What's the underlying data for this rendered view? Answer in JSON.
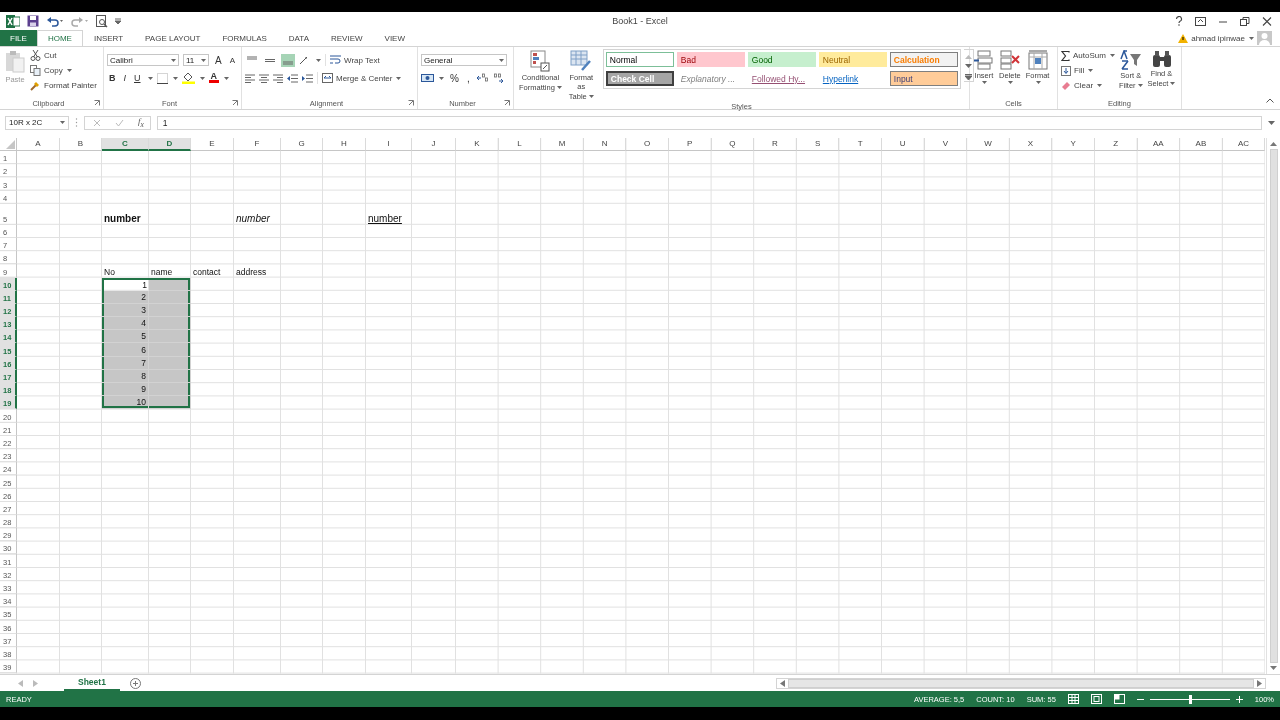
{
  "window": {
    "title": "Book1 - Excel",
    "user": "ahmad ipinwae"
  },
  "tabs": [
    {
      "label": "FILE",
      "kind": "file",
      "selected": false
    },
    {
      "label": "HOME",
      "kind": "tab",
      "selected": true
    },
    {
      "label": "INSERT",
      "kind": "tab",
      "selected": false
    },
    {
      "label": "PAGE LAYOUT",
      "kind": "tab",
      "selected": false
    },
    {
      "label": "FORMULAS",
      "kind": "tab",
      "selected": false
    },
    {
      "label": "DATA",
      "kind": "tab",
      "selected": false
    },
    {
      "label": "REVIEW",
      "kind": "tab",
      "selected": false
    },
    {
      "label": "VIEW",
      "kind": "tab",
      "selected": false
    }
  ],
  "ribbon": {
    "clipboard": {
      "label": "Clipboard",
      "paste": "Paste",
      "actions": [
        "Cut",
        "Copy",
        "Format Painter"
      ]
    },
    "font": {
      "label": "Font",
      "family": "Calibri",
      "size": "11",
      "grow": "A",
      "shrink": "A",
      "bold": "B",
      "italic": "I",
      "underline": "U",
      "color_letter": "A"
    },
    "alignment": {
      "label": "Alignment",
      "vertical": [
        {
          "selected": false
        },
        {
          "selected": false
        },
        {
          "selected": true
        }
      ],
      "wrap": "Wrap Text",
      "merge": "Merge & Center"
    },
    "number": {
      "label": "Number",
      "format": "General",
      "percent": "%",
      "comma": ","
    },
    "styles": {
      "label": "Styles",
      "conditional": [
        "Conditional",
        "Formatting"
      ],
      "format_table": [
        "Format as",
        "Table"
      ],
      "gallery": [
        {
          "label": "Normal",
          "kind": "normal",
          "selected": true
        },
        {
          "label": "Bad",
          "kind": "bad",
          "selected": false
        },
        {
          "label": "Good",
          "kind": "good",
          "selected": false
        },
        {
          "label": "Neutral",
          "kind": "neutral",
          "selected": false
        },
        {
          "label": "Calculation",
          "kind": "calculation",
          "selected": false
        },
        {
          "label": "Check Cell",
          "kind": "check",
          "selected": false
        },
        {
          "label": "Explanatory ...",
          "kind": "explanatory",
          "selected": false
        },
        {
          "label": "Followed Hy...",
          "kind": "followed",
          "selected": false
        },
        {
          "label": "Hyperlink",
          "kind": "hyperlink",
          "selected": false
        },
        {
          "label": "Input",
          "kind": "input",
          "selected": false
        }
      ]
    },
    "cells": {
      "label": "Cells",
      "buttons": [
        "Insert",
        "Delete",
        "Format"
      ]
    },
    "editing": {
      "label": "Editing",
      "autosum": "AutoSum",
      "fill": "Fill",
      "clear": "Clear",
      "sort": [
        "Sort &",
        "Filter"
      ],
      "find": [
        "Find &",
        "Select"
      ]
    }
  },
  "formula_bar": {
    "name_box": "10R x 2C",
    "function_label": "f$_{x}$",
    "value": "1"
  },
  "sheet": {
    "columns": [
      {
        "label": "A",
        "selected": false
      },
      {
        "label": "B",
        "selected": false
      },
      {
        "label": "C",
        "selected": true
      },
      {
        "label": "D",
        "selected": true
      },
      {
        "label": "E",
        "selected": false
      },
      {
        "label": "F",
        "selected": false
      },
      {
        "label": "G",
        "selected": false
      },
      {
        "label": "H",
        "selected": false
      },
      {
        "label": "I",
        "selected": false
      },
      {
        "label": "J",
        "selected": false
      },
      {
        "label": "K",
        "selected": false
      },
      {
        "label": "L",
        "selected": false
      },
      {
        "label": "M",
        "selected": false
      },
      {
        "label": "N",
        "selected": false
      },
      {
        "label": "O",
        "selected": false
      },
      {
        "label": "P",
        "selected": false
      },
      {
        "label": "Q",
        "selected": false
      },
      {
        "label": "R",
        "selected": false
      },
      {
        "label": "S",
        "selected": false
      },
      {
        "label": "T",
        "selected": false
      },
      {
        "label": "U",
        "selected": false
      },
      {
        "label": "V",
        "selected": false
      },
      {
        "label": "W",
        "selected": false
      },
      {
        "label": "X",
        "selected": false
      },
      {
        "label": "Y",
        "selected": false
      },
      {
        "label": "Z",
        "selected": false
      },
      {
        "label": "AA",
        "selected": false
      },
      {
        "label": "AB",
        "selected": false
      },
      {
        "label": "AC",
        "selected": false
      }
    ],
    "rows": [
      {
        "label": "1",
        "selected": false
      },
      {
        "label": "2",
        "selected": false
      },
      {
        "label": "3",
        "selected": false
      },
      {
        "label": "4",
        "selected": false
      },
      {
        "label": "5",
        "selected": false,
        "cells": [
          null,
          null,
          {
            "text": "number",
            "kind": "bold",
            "selected": false
          },
          null,
          null,
          {
            "text": "number",
            "kind": "italic",
            "selected": false
          },
          null,
          null,
          {
            "text": "number",
            "kind": "underlined",
            "selected": false
          }
        ]
      },
      {
        "label": "6",
        "selected": false
      },
      {
        "label": "7",
        "selected": false
      },
      {
        "label": "8",
        "selected": false
      },
      {
        "label": "9",
        "selected": false,
        "cells": [
          null,
          null,
          {
            "text": "No",
            "selected": false
          },
          {
            "text": "name",
            "selected": false
          },
          {
            "text": "contact",
            "selected": false
          },
          {
            "text": "address",
            "selected": false
          }
        ]
      },
      {
        "label": "10",
        "selected": true,
        "cells": [
          null,
          null,
          {
            "text": "1",
            "kind": "number",
            "selected": true,
            "active": true
          },
          {
            "selected": true
          }
        ]
      },
      {
        "label": "11",
        "selected": true,
        "cells": [
          null,
          null,
          {
            "text": "2",
            "kind": "number",
            "selected": true
          },
          {
            "selected": true
          }
        ]
      },
      {
        "label": "12",
        "selected": true,
        "cells": [
          null,
          null,
          {
            "text": "3",
            "kind": "number",
            "selected": true
          },
          {
            "selected": true
          }
        ]
      },
      {
        "label": "13",
        "selected": true,
        "cells": [
          null,
          null,
          {
            "text": "4",
            "kind": "number",
            "selected": true
          },
          {
            "selected": true
          }
        ]
      },
      {
        "label": "14",
        "selected": true,
        "cells": [
          null,
          null,
          {
            "text": "5",
            "kind": "number",
            "selected": true
          },
          {
            "selected": true
          }
        ]
      },
      {
        "label": "15",
        "selected": true,
        "cells": [
          null,
          null,
          {
            "text": "6",
            "kind": "number",
            "selected": true
          },
          {
            "selected": true
          }
        ]
      },
      {
        "label": "16",
        "selected": true,
        "cells": [
          null,
          null,
          {
            "text": "7",
            "kind": "number",
            "selected": true
          },
          {
            "selected": true
          }
        ]
      },
      {
        "label": "17",
        "selected": true,
        "cells": [
          null,
          null,
          {
            "text": "8",
            "kind": "number",
            "selected": true
          },
          {
            "selected": true
          }
        ]
      },
      {
        "label": "18",
        "selected": true,
        "cells": [
          null,
          null,
          {
            "text": "9",
            "kind": "number",
            "selected": true
          },
          {
            "selected": true
          }
        ]
      },
      {
        "label": "19",
        "selected": true,
        "cells": [
          null,
          null,
          {
            "text": "10",
            "kind": "number",
            "selected": true
          },
          {
            "selected": true
          }
        ]
      },
      {
        "label": "20",
        "selected": false
      },
      {
        "label": "21",
        "selected": false
      },
      {
        "label": "22",
        "selected": false
      },
      {
        "label": "23",
        "selected": false
      },
      {
        "label": "24",
        "selected": false
      },
      {
        "label": "25",
        "selected": false
      },
      {
        "label": "26",
        "selected": false
      },
      {
        "label": "27",
        "selected": false
      },
      {
        "label": "28",
        "selected": false
      },
      {
        "label": "29",
        "selected": false
      },
      {
        "label": "30",
        "selected": false
      },
      {
        "label": "31",
        "selected": false
      },
      {
        "label": "32",
        "selected": false
      },
      {
        "label": "33",
        "selected": false
      },
      {
        "label": "34",
        "selected": false
      },
      {
        "label": "35",
        "selected": false
      },
      {
        "label": "36",
        "selected": false
      },
      {
        "label": "37",
        "selected": false
      },
      {
        "label": "38",
        "selected": false
      },
      {
        "label": "39",
        "selected": false
      }
    ]
  },
  "sheet_tabs": [
    {
      "label": "Sheet1",
      "selected": true
    }
  ],
  "status_bar": {
    "mode": "READY",
    "stats": [
      "AVERAGE: 5,5",
      "COUNT: 10",
      "SUM: 55"
    ],
    "zoom": "100%",
    "zoom_slider": {
      "level": 0.5
    }
  }
}
